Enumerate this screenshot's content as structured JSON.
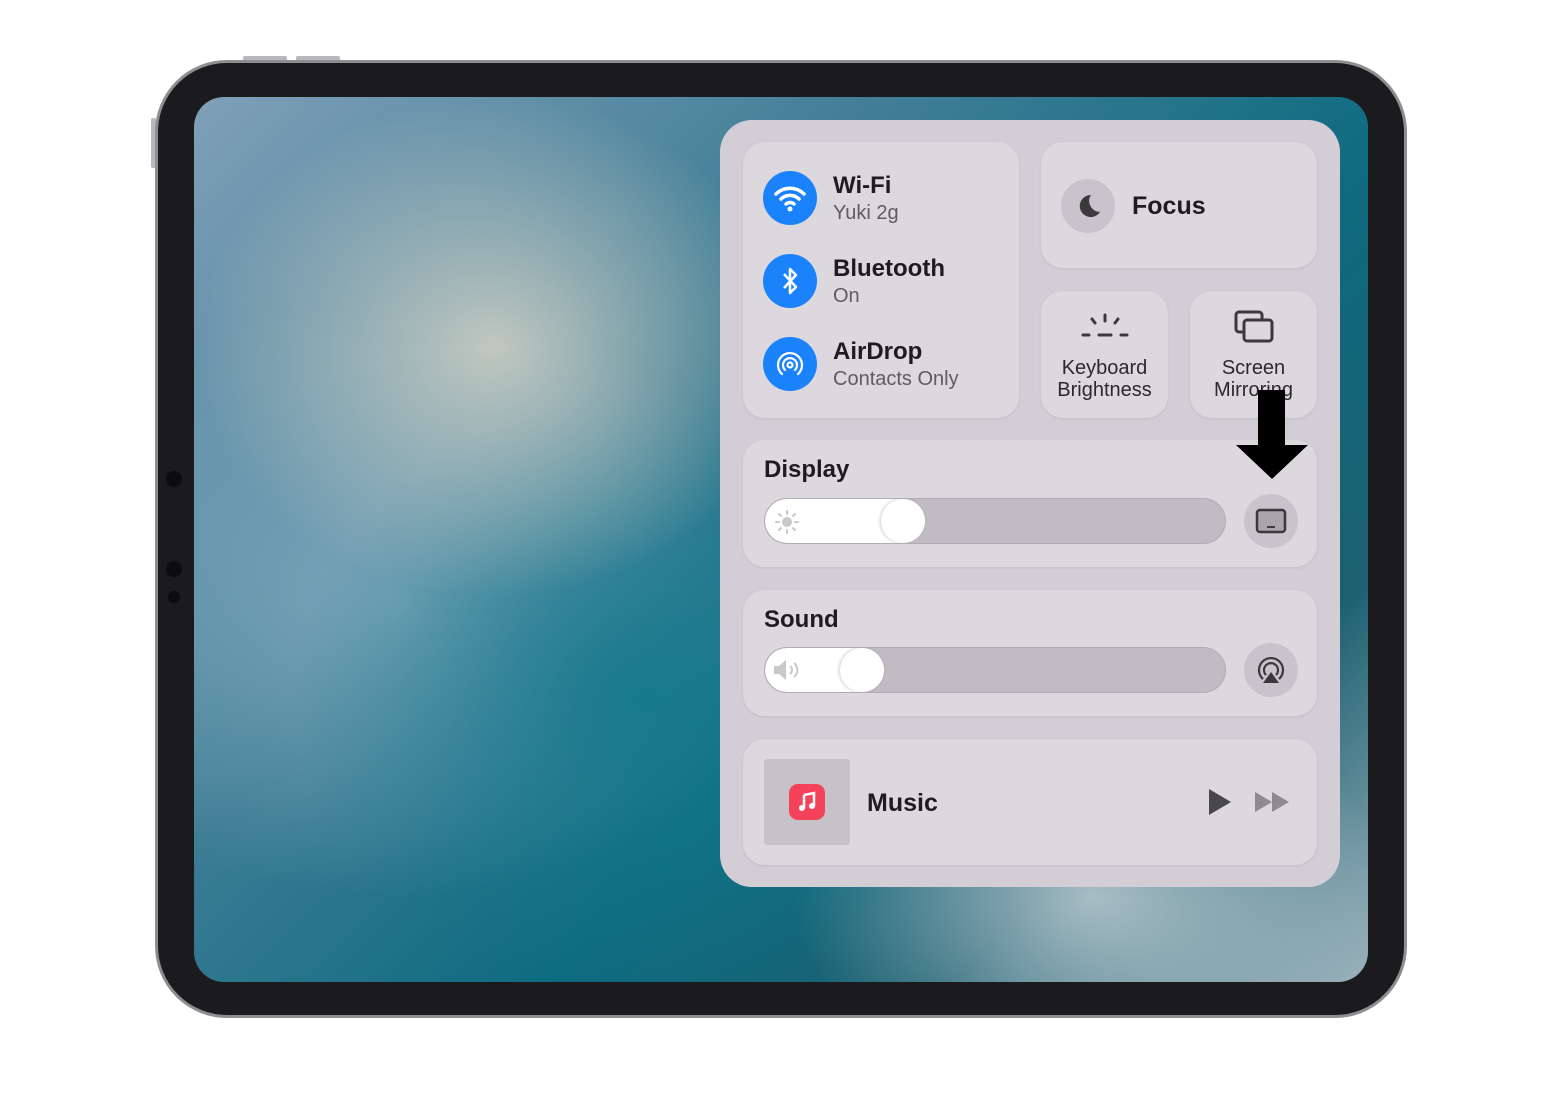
{
  "control_center": {
    "wifi": {
      "title": "Wi-Fi",
      "subtitle": "Yuki 2g",
      "icon": "wifi-icon"
    },
    "bluetooth": {
      "title": "Bluetooth",
      "subtitle": "On",
      "icon": "bluetooth-icon"
    },
    "airdrop": {
      "title": "AirDrop",
      "subtitle": "Contacts Only",
      "icon": "airdrop-icon"
    },
    "focus": {
      "label": "Focus",
      "icon": "moon-icon"
    },
    "keyboard_brightness": {
      "line1": "Keyboard",
      "line2": "Brightness"
    },
    "screen_mirroring": {
      "line1": "Screen",
      "line2": "Mirroring"
    },
    "display": {
      "label": "Display",
      "level_percent": 30
    },
    "sound": {
      "label": "Sound",
      "level_percent": 21
    },
    "music": {
      "label": "Music"
    }
  },
  "colors": {
    "accent": "#1a82fb",
    "music_icon": "#f3425a"
  },
  "annotation": {
    "icon": "arrow-down-icon"
  }
}
